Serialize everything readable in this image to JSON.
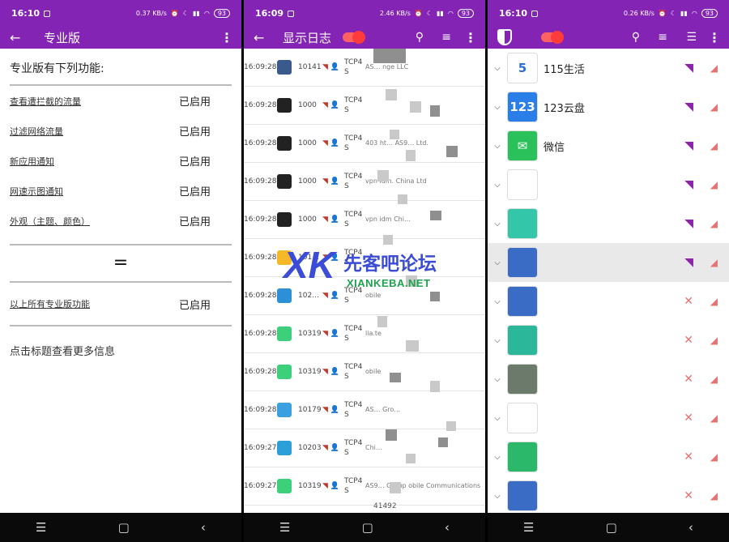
{
  "panel1": {
    "status_time": "16:10",
    "status_speed": "0.37 KB/s",
    "battery": "93",
    "title": "专业版",
    "heading": "专业版有下列功能:",
    "features": [
      {
        "name": "查看遭拦截的流量",
        "state": "已启用"
      },
      {
        "name": "过滤网络流量",
        "state": "已启用"
      },
      {
        "name": "新应用通知",
        "state": "已启用"
      },
      {
        "name": "网速示图通知",
        "state": "已启用"
      },
      {
        "name": "外观（主题、颜色）",
        "state": "已启用"
      }
    ],
    "equals": "=",
    "all_features": {
      "name": "以上所有专业版功能",
      "state": "已启用"
    },
    "more_info": "点击标题查看更多信息"
  },
  "panel2": {
    "status_time": "16:09",
    "status_speed": "2.46 KB/s",
    "battery": "93",
    "title": "显示日志",
    "rows": [
      {
        "time": "16:09:28",
        "uid": "10141",
        "proto": "TCP4 S",
        "info": "AS… nge LLC",
        "color": "#3a5a8c"
      },
      {
        "time": "16:09:28",
        "uid": "1000",
        "proto": "TCP4 S",
        "info": "",
        "color": "#222222"
      },
      {
        "time": "16:09:28",
        "uid": "1000",
        "proto": "TCP4 S",
        "info": "403 ht… AS9… Ltd.",
        "color": "#222222"
      },
      {
        "time": "16:09:28",
        "uid": "1000",
        "proto": "TCP4 S",
        "info": "vpn idm. China Ltd",
        "color": "#222222"
      },
      {
        "time": "16:09:28",
        "uid": "1000",
        "proto": "TCP4 S",
        "info": "vpn idm Chi…",
        "color": "#222222"
      },
      {
        "time": "16:09:28",
        "uid": "101…",
        "proto": "TCP4 S",
        "info": "",
        "color": "#f5b829"
      },
      {
        "time": "16:09:28",
        "uid": "102…",
        "proto": "TCP4 S",
        "info": "obile",
        "color": "#2d8fd5"
      },
      {
        "time": "16:09:28",
        "uid": "10319",
        "proto": "TCP4 S",
        "info": "lia.te",
        "color": "#3ecf7a"
      },
      {
        "time": "16:09:28",
        "uid": "10319",
        "proto": "TCP4 S",
        "info": "obile",
        "color": "#3ecf7a"
      },
      {
        "time": "16:09:28",
        "uid": "10179",
        "proto": "TCP4 S",
        "info": "AS… Gro…",
        "color": "#3aa0e0"
      },
      {
        "time": "16:09:27",
        "uid": "10203",
        "proto": "TCP4 S",
        "info": "Chi…",
        "color": "#2b9fd8"
      },
      {
        "time": "16:09:27",
        "uid": "10319",
        "proto": "TCP4 S",
        "info": "AS9… Group obile Communications",
        "color": "#3ecf7a"
      }
    ],
    "tail": "41492"
  },
  "panel3": {
    "status_time": "16:10",
    "status_speed": "0.26 KB/s",
    "battery": "93",
    "apps": [
      {
        "name": "115生活",
        "icon_text": "5",
        "icon_bg": "#ffffff",
        "icon_fg": "#2a6fd1",
        "allowed": true,
        "grey": false
      },
      {
        "name": "123云盘",
        "icon_text": "123",
        "icon_bg": "#2a7ee8",
        "icon_fg": "#ffffff",
        "allowed": true,
        "grey": false
      },
      {
        "name": "微信",
        "icon_text": "✉",
        "icon_bg": "#2bc15a",
        "icon_fg": "#ffffff",
        "allowed": true,
        "grey": false
      },
      {
        "name": "",
        "icon_text": "",
        "icon_bg": "#ffffff",
        "icon_fg": "#000000",
        "allowed": true,
        "grey": false
      },
      {
        "name": "",
        "icon_text": "",
        "icon_bg": "#34c6a8",
        "icon_fg": "#ffffff",
        "allowed": true,
        "grey": false
      },
      {
        "name": "",
        "icon_text": "",
        "icon_bg": "#3b6cc5",
        "icon_fg": "#ffffff",
        "allowed": true,
        "grey": true
      },
      {
        "name": "",
        "icon_text": "",
        "icon_bg": "#3b6cc5",
        "icon_fg": "#ffffff",
        "allowed": false,
        "grey": false
      },
      {
        "name": "",
        "icon_text": "",
        "icon_bg": "#2bb89a",
        "icon_fg": "#ffffff",
        "allowed": false,
        "grey": false
      },
      {
        "name": "",
        "icon_text": "",
        "icon_bg": "#6c7a6c",
        "icon_fg": "#ffffff",
        "allowed": false,
        "grey": false
      },
      {
        "name": "",
        "icon_text": "",
        "icon_bg": "#ffffff",
        "icon_fg": "#000000",
        "allowed": false,
        "grey": false
      },
      {
        "name": "",
        "icon_text": "",
        "icon_bg": "#2bb86a",
        "icon_fg": "#ffffff",
        "allowed": false,
        "grey": false
      },
      {
        "name": "",
        "icon_text": "",
        "icon_bg": "#3b6cc5",
        "icon_fg": "#ffffff",
        "allowed": false,
        "grey": false
      }
    ]
  },
  "watermark": {
    "logo": "XK",
    "cn": "先客吧论坛",
    "en": "XIANKEBA.NET"
  }
}
